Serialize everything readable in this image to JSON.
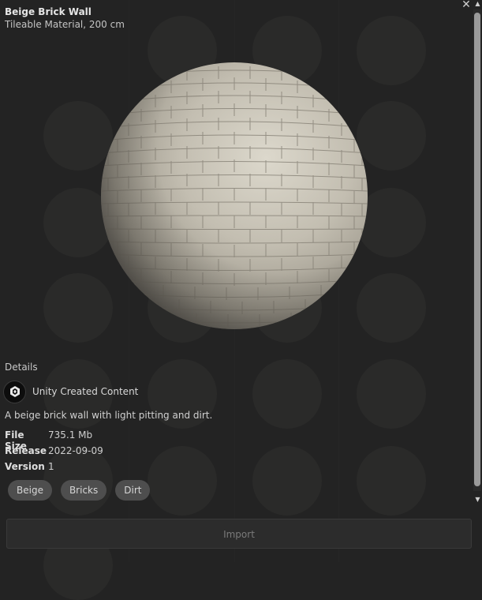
{
  "header": {
    "title": "Beige Brick Wall",
    "subtitle": "Tileable Material, 200 cm"
  },
  "details": {
    "heading": "Details",
    "creator": "Unity Created Content",
    "description": "A beige brick wall with light pitting and dirt.",
    "file_size_label": "File Size",
    "file_size": "735.1 Mb",
    "release_label": "Release",
    "release": "2022-09-09",
    "version_label": "Version",
    "version": "1"
  },
  "tags": [
    "Beige",
    "Bricks",
    "Dirt"
  ],
  "import_button": "Import",
  "icons": {
    "close": "close-icon",
    "scroll_up": "scroll-up-arrow-icon",
    "scroll_down": "scroll-down-arrow-icon",
    "creator_avatar": "unity-logo-icon"
  },
  "colors": {
    "background": "#232323",
    "tag": "#4e4e4e",
    "sphere": "#c5bfb1"
  }
}
